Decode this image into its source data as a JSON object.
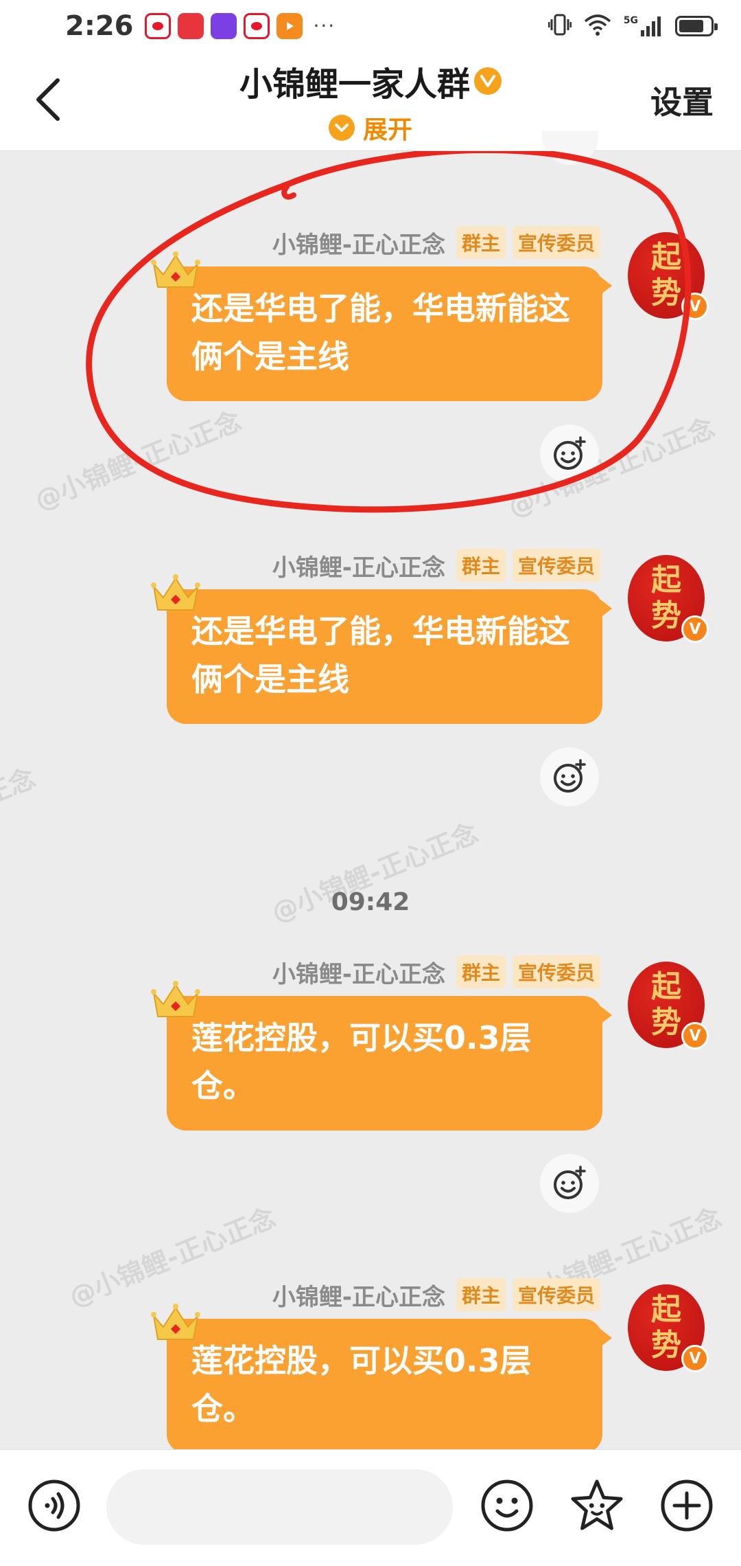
{
  "status_bar": {
    "time": "2:26",
    "notification_icons": [
      "weibo-icon",
      "huawei-mall-icon",
      "shenma-icon",
      "weibo-icon",
      "video-icon"
    ],
    "more": "···",
    "network": "5G"
  },
  "header": {
    "title": "小锦鲤一家人群",
    "expand_label": "展开",
    "settings_label": "设置"
  },
  "messages": [
    {
      "sender": "小锦鲤-正心正念",
      "tags": [
        "群主",
        "宣传委员"
      ],
      "text": "还是华电了能，华电新能这俩个是主线",
      "avatar_text": [
        "起",
        "势"
      ]
    },
    {
      "sender": "小锦鲤-正心正念",
      "tags": [
        "群主",
        "宣传委员"
      ],
      "text": "还是华电了能，华电新能这俩个是主线",
      "avatar_text": [
        "起",
        "势"
      ]
    },
    {
      "sender": "小锦鲤-正心正念",
      "tags": [
        "群主",
        "宣传委员"
      ],
      "text": "莲花控股，可以买0.3层仓。",
      "avatar_text": [
        "起",
        "势"
      ]
    },
    {
      "sender": "小锦鲤-正心正念",
      "tags": [
        "群主",
        "宣传委员"
      ],
      "text": "莲花控股，可以买0.3层仓。",
      "avatar_text": [
        "起",
        "势"
      ]
    }
  ],
  "timestamp": "09:42",
  "watermark_text": "@小锦鲤-正心正念",
  "colors": {
    "bubble": "#fba132",
    "accent": "#f7a21b",
    "annotation": "#e8261e",
    "background": "#ececec"
  }
}
